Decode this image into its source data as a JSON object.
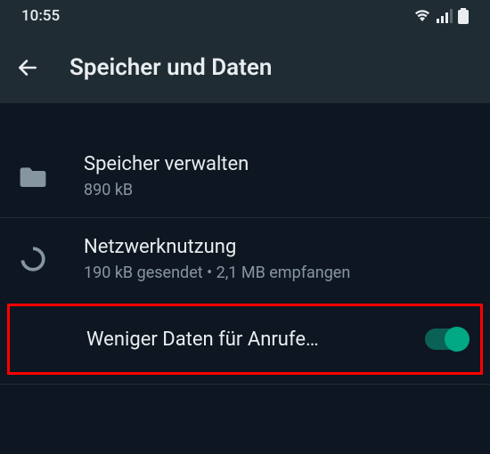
{
  "statusbar": {
    "time": "10:55"
  },
  "header": {
    "title": "Speicher und Daten"
  },
  "rows": {
    "storage": {
      "title": "Speicher verwalten",
      "sub": "890 kB"
    },
    "network": {
      "title": "Netzwerknutzung",
      "sub": "190 kB gesendet • 2,1 MB empfangen"
    },
    "lowdata": {
      "title": "Weniger Daten für Anrufe…"
    }
  }
}
